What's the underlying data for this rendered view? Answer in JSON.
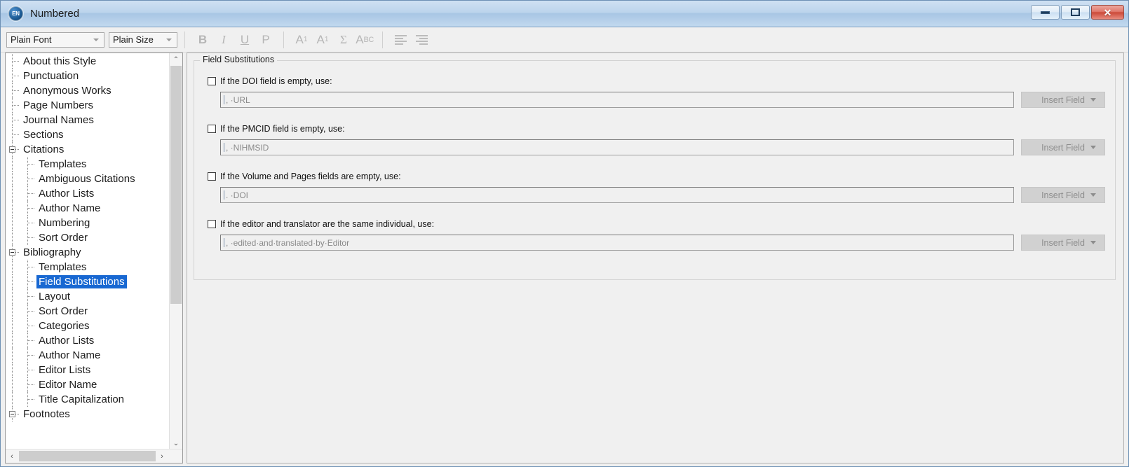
{
  "window": {
    "title": "Numbered",
    "icon": "EN",
    "buttons": {
      "minimize": "minimize",
      "maximize": "maximize",
      "close": "✕"
    }
  },
  "toolbar": {
    "font_combo": "Plain Font",
    "size_combo": "Plain Size",
    "buttons": [
      {
        "name": "bold-button",
        "glyph": "B"
      },
      {
        "name": "italic-button",
        "glyph": "I"
      },
      {
        "name": "underline-button",
        "glyph": "U"
      },
      {
        "name": "plain-button",
        "glyph": "P"
      },
      {
        "name": "superscript-button",
        "glyph": "A1"
      },
      {
        "name": "subscript-button",
        "glyph": "A1"
      },
      {
        "name": "link-adjacent-button",
        "glyph": "Σ"
      },
      {
        "name": "small-caps-button",
        "glyph": "ABC"
      },
      {
        "name": "align-left-button",
        "glyph": "align"
      },
      {
        "name": "align-right-button",
        "glyph": "align"
      }
    ]
  },
  "tree": {
    "items": [
      {
        "label": "About this Style",
        "level": 1,
        "expander": false,
        "selected": false
      },
      {
        "label": "Punctuation",
        "level": 1,
        "expander": false,
        "selected": false
      },
      {
        "label": "Anonymous Works",
        "level": 1,
        "expander": false,
        "selected": false
      },
      {
        "label": "Page Numbers",
        "level": 1,
        "expander": false,
        "selected": false
      },
      {
        "label": "Journal Names",
        "level": 1,
        "expander": false,
        "selected": false
      },
      {
        "label": "Sections",
        "level": 1,
        "expander": false,
        "selected": false
      },
      {
        "label": "Citations",
        "level": 1,
        "expander": true,
        "selected": false
      },
      {
        "label": "Templates",
        "level": 2,
        "expander": false,
        "selected": false
      },
      {
        "label": "Ambiguous Citations",
        "level": 2,
        "expander": false,
        "selected": false
      },
      {
        "label": "Author Lists",
        "level": 2,
        "expander": false,
        "selected": false
      },
      {
        "label": "Author Name",
        "level": 2,
        "expander": false,
        "selected": false
      },
      {
        "label": "Numbering",
        "level": 2,
        "expander": false,
        "selected": false
      },
      {
        "label": "Sort Order",
        "level": 2,
        "expander": false,
        "selected": false
      },
      {
        "label": "Bibliography",
        "level": 1,
        "expander": true,
        "selected": false
      },
      {
        "label": "Templates",
        "level": 2,
        "expander": false,
        "selected": false
      },
      {
        "label": "Field Substitutions",
        "level": 2,
        "expander": false,
        "selected": true
      },
      {
        "label": "Layout",
        "level": 2,
        "expander": false,
        "selected": false
      },
      {
        "label": "Sort Order",
        "level": 2,
        "expander": false,
        "selected": false
      },
      {
        "label": "Categories",
        "level": 2,
        "expander": false,
        "selected": false
      },
      {
        "label": "Author Lists",
        "level": 2,
        "expander": false,
        "selected": false
      },
      {
        "label": "Author Name",
        "level": 2,
        "expander": false,
        "selected": false
      },
      {
        "label": "Editor Lists",
        "level": 2,
        "expander": false,
        "selected": false
      },
      {
        "label": "Editor Name",
        "level": 2,
        "expander": false,
        "selected": false
      },
      {
        "label": "Title Capitalization",
        "level": 2,
        "expander": false,
        "selected": false
      },
      {
        "label": "Footnotes",
        "level": 1,
        "expander": true,
        "selected": false
      }
    ],
    "scrollbar": {
      "up_arrow": "⌃",
      "down_arrow": "⌄",
      "left_arrow": "‹",
      "right_arrow": "›"
    }
  },
  "panel": {
    "group_title": "Field Substitutions",
    "rows": [
      {
        "checkbox_label": "If the DOI field is empty, use:",
        "checked": false,
        "field_value": ", ·URL",
        "button_label": "Insert Field"
      },
      {
        "checkbox_label": "If the PMCID field is empty, use:",
        "checked": false,
        "field_value": ", ·NIHMSID",
        "button_label": "Insert Field"
      },
      {
        "checkbox_label": "If the Volume and Pages fields are empty, use:",
        "checked": false,
        "field_value": ". ·DOI",
        "button_label": "Insert Field"
      },
      {
        "checkbox_label": "If the editor and translator are the same individual, use:",
        "checked": false,
        "field_value": ", ·edited·and·translated·by·Editor",
        "button_label": "Insert Field"
      }
    ]
  },
  "colors": {
    "selection": "#1868d2",
    "titlebar_accent": "#a8c6e4",
    "close_button": "#cb4a39"
  }
}
